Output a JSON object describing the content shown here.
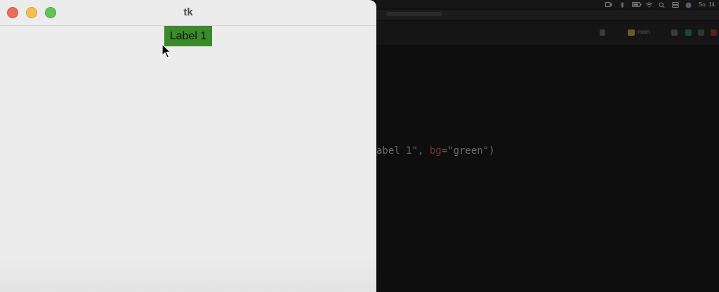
{
  "tk_window": {
    "title": "tk",
    "label": {
      "text": "Label 1",
      "bg": "#3b8a2c",
      "fg": "#111111"
    },
    "traffic_lights": {
      "close_color": "#ed6a5e",
      "minimize_color": "#f5bf4f",
      "zoom_color": "#61c554"
    }
  },
  "background": {
    "menubar": {
      "clock": "So. 14",
      "icons": [
        "screen-record-icon",
        "bluetooth-icon",
        "battery-icon",
        "wifi-icon",
        "search-icon",
        "control-center-icon",
        "siri-icon"
      ]
    },
    "toolbar": {
      "run_config_label": "main"
    },
    "editor": {
      "code_prefix": "abel 1\", ",
      "code_kw": "bg",
      "code_suffix": "=\"green\")"
    }
  },
  "cursor": {
    "icon": "arrow-pointer-icon"
  }
}
